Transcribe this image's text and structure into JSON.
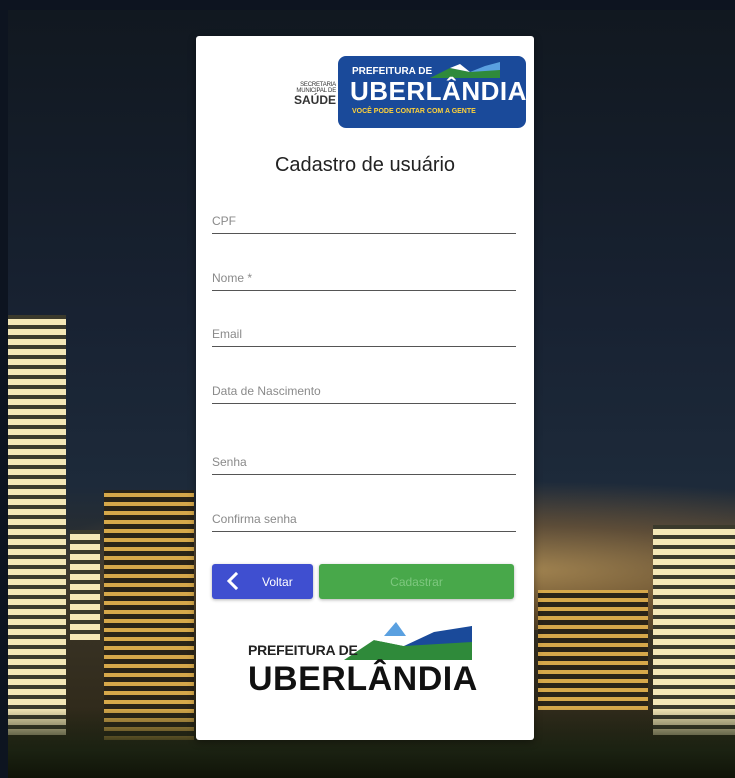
{
  "header": {
    "secretaria_line1": "SECRETARIA",
    "secretaria_line2": "MUNICIPAL DE",
    "secretaria_line3": "SAÚDE",
    "prefeitura_top": "PREFEITURA DE",
    "prefeitura_name": "UBERLÂNDIA",
    "prefeitura_slogan": "VOCÊ PODE CONTAR COM A GENTE"
  },
  "form": {
    "title": "Cadastro de usuário",
    "fields": [
      {
        "label": "CPF",
        "value": ""
      },
      {
        "label": "Nome *",
        "value": ""
      },
      {
        "label": "Email",
        "value": ""
      },
      {
        "label": "Data de Nascimento",
        "value": ""
      },
      {
        "label": "Senha",
        "value": ""
      },
      {
        "label": "Confirma senha",
        "value": ""
      }
    ],
    "back_label": "Voltar",
    "submit_label": "Cadastrar"
  },
  "footer": {
    "prefeitura_top": "PREFEITURA DE",
    "prefeitura_name": "UBERLÂNDIA"
  },
  "colors": {
    "back_button": "#3f4fd0",
    "submit_button": "#48a84a",
    "brand_blue": "#1a4a9a"
  }
}
